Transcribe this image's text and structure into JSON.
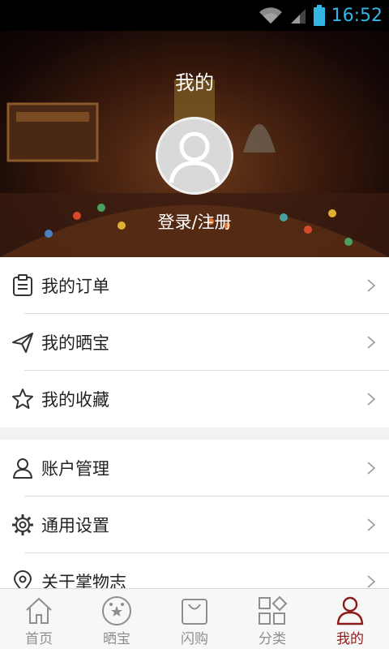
{
  "status_bar": {
    "time": "16:52"
  },
  "header": {
    "title": "我的",
    "login_text": "登录/注册"
  },
  "menu_group_1": [
    {
      "label": "我的订单",
      "icon": "clipboard-icon"
    },
    {
      "label": "我的晒宝",
      "icon": "paper-plane-icon"
    },
    {
      "label": "我的收藏",
      "icon": "star-icon"
    }
  ],
  "menu_group_2": [
    {
      "label": "账户管理",
      "icon": "user-icon"
    },
    {
      "label": "通用设置",
      "icon": "gear-icon"
    },
    {
      "label": "关于掌物志",
      "icon": "location-pin-icon"
    }
  ],
  "tabbar": [
    {
      "label": "首页",
      "icon": "home-icon"
    },
    {
      "label": "晒宝",
      "icon": "stars-circle-icon"
    },
    {
      "label": "闪购",
      "icon": "shopping-bag-icon"
    },
    {
      "label": "分类",
      "icon": "category-grid-icon"
    },
    {
      "label": "我的",
      "icon": "profile-icon",
      "active": true
    }
  ],
  "colors": {
    "accent": "#8b1a1a",
    "status_time": "#33b5e5",
    "tab_inactive": "#8e8e8e"
  }
}
